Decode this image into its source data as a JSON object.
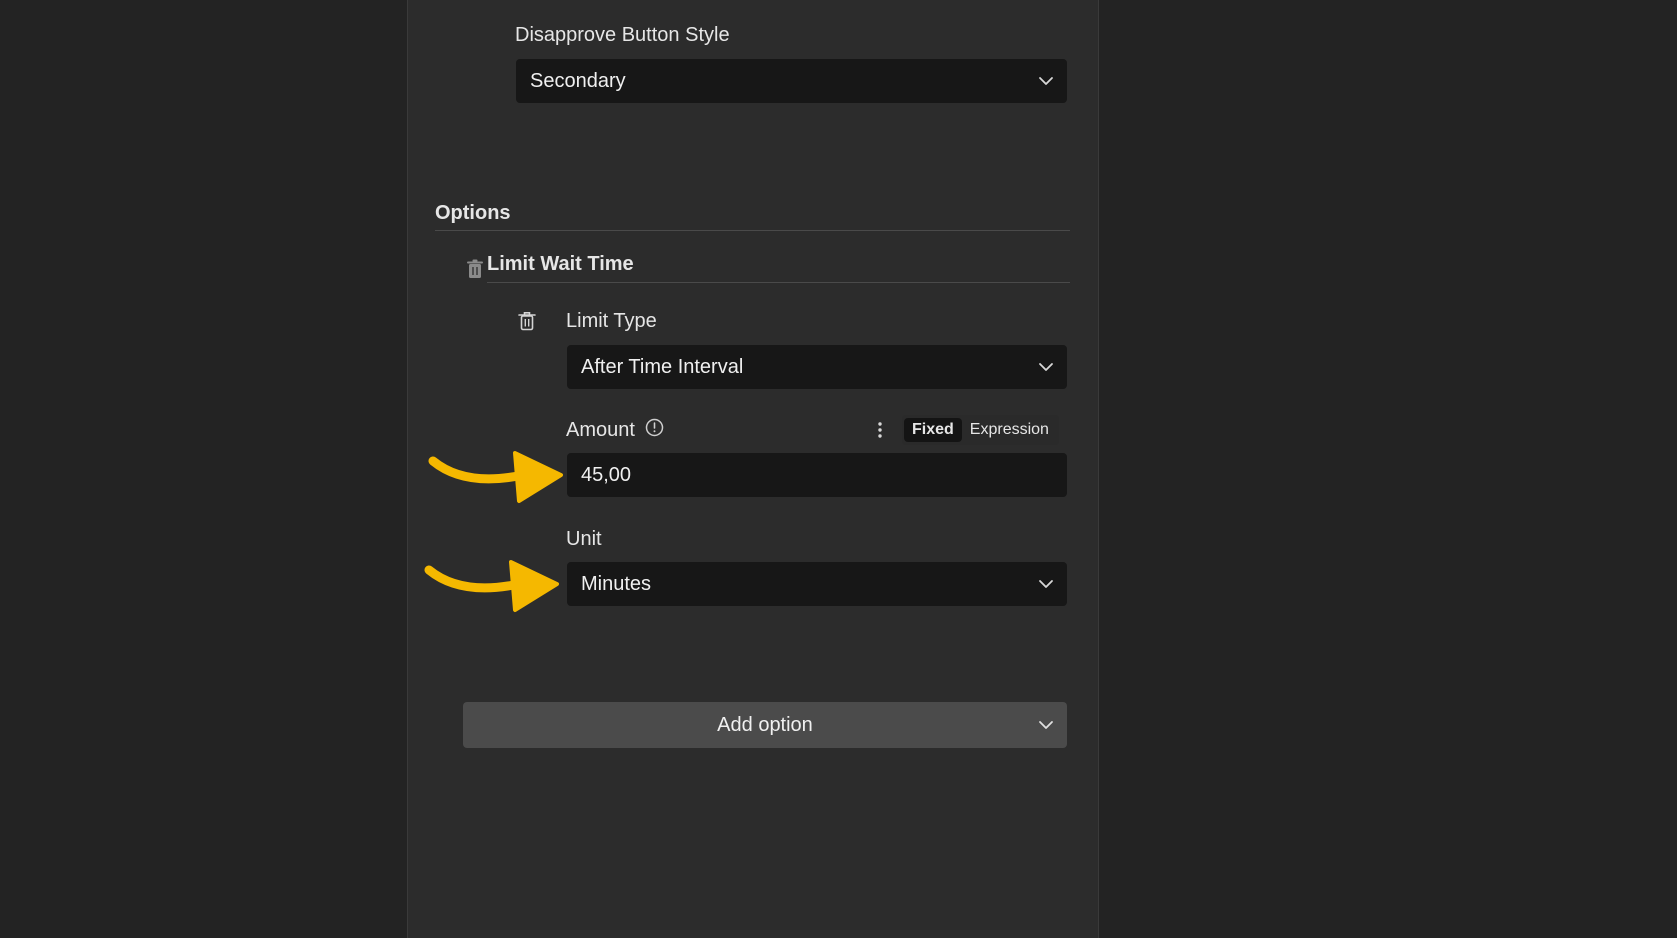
{
  "disapprove": {
    "label": "Disapprove Button Style",
    "value": "Secondary"
  },
  "options": {
    "heading": "Options",
    "group_title": "Limit Wait Time",
    "limit_type": {
      "label": "Limit Type",
      "value": "After Time Interval"
    },
    "amount": {
      "label": "Amount",
      "value": "45,00",
      "mode_fixed": "Fixed",
      "mode_expression": "Expression",
      "active_mode": "Fixed"
    },
    "unit": {
      "label": "Unit",
      "value": "Minutes"
    }
  },
  "add_option": {
    "label": "Add option"
  },
  "colors": {
    "arrow": "#F5B800",
    "field_bg": "#171717",
    "panel_bg": "#2C2C2C"
  }
}
